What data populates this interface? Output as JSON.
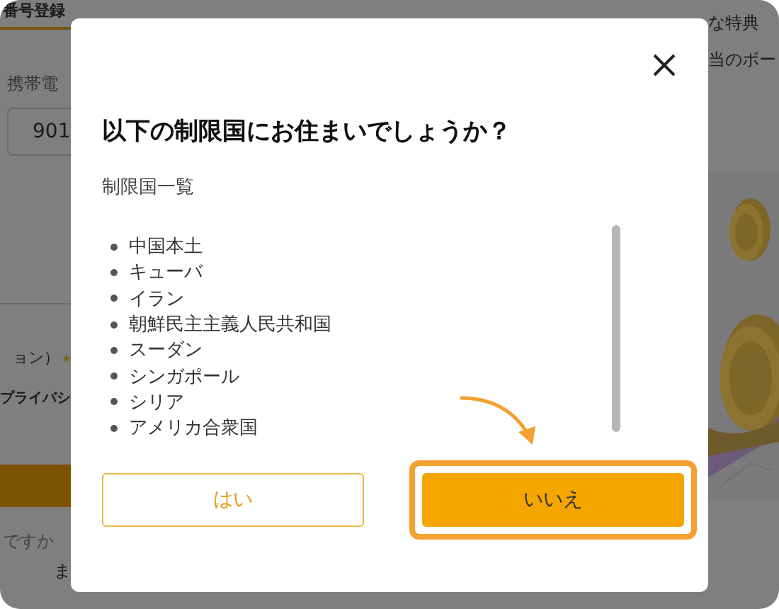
{
  "background_page": {
    "tab": "番号登録",
    "phone_label": "携帯電",
    "phone_value": "901",
    "option_text": "ョン）",
    "privacy_text": "プライバシ",
    "question_text": "ですか",
    "link_text": "ま",
    "promo_lines": [
      "な特典",
      "当のボー"
    ]
  },
  "dialog": {
    "title": "以下の制限国にお住まいでしょうか？",
    "list_heading": "制限国一覧",
    "countries": [
      "中国本土",
      "キューバ",
      "イラン",
      "朝鮮民主主義人民共和国",
      "スーダン",
      "シンガポール",
      "シリア",
      "アメリカ合衆国"
    ],
    "buttons": [
      {
        "label": "はい",
        "kind": "outline",
        "highlighted": false
      },
      {
        "label": "いいえ",
        "kind": "primary",
        "highlighted": true
      }
    ]
  }
}
